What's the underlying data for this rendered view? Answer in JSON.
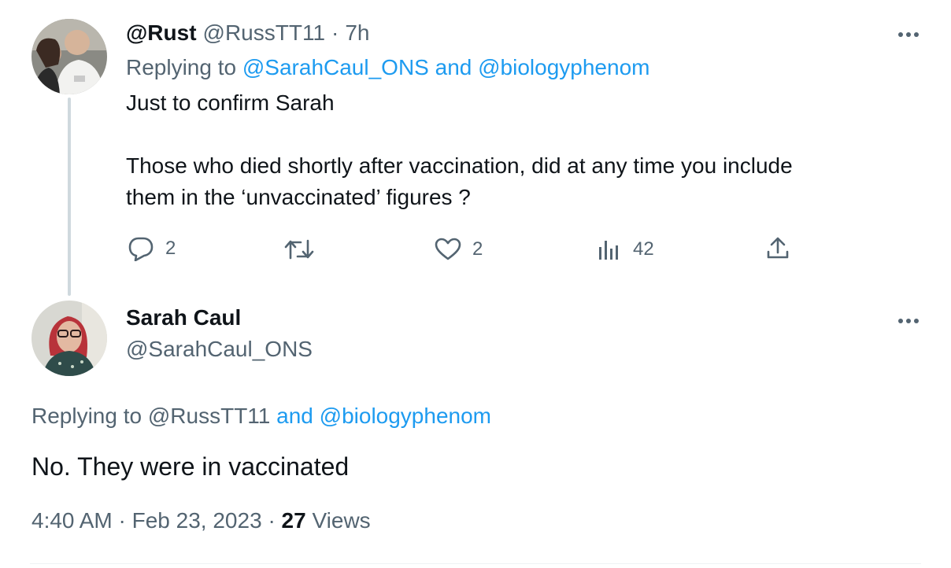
{
  "reply_tweet": {
    "author_name": "@Rust",
    "author_handle": "@RussTT11",
    "separator": "·",
    "time_ago": "7h",
    "replying_prefix": "Replying to",
    "replying_mentions": "@SarahCaul_ONS and @biologyphenom",
    "body_line1": "Just to confirm Sarah",
    "body_line2": "Those who died shortly after vaccination, did at any time you include",
    "body_line3": "them in the ‘unvaccinated’ figures ?",
    "actions": {
      "reply_count": "2",
      "retweet_count": "",
      "like_count": "2",
      "views_count": "42"
    },
    "icons": [
      "reply-icon",
      "retweet-icon",
      "like-icon",
      "views-icon",
      "share-icon",
      "more-icon"
    ]
  },
  "main_tweet": {
    "author_name": "Sarah Caul",
    "author_handle": "@SarahCaul_ONS",
    "replying_prefix": "Replying to",
    "replying_user": "@RussTT11",
    "replying_rest": "and @biologyphenom",
    "body": "No. They were in vaccinated",
    "time": "4:40 AM",
    "separator": "·",
    "date": "Feb 23, 2023",
    "views_count": "27",
    "views_label": "Views"
  },
  "colors": {
    "link": "#1d9bf0",
    "muted": "#536471",
    "text": "#0f1419",
    "thread_line": "#cfd9de"
  }
}
